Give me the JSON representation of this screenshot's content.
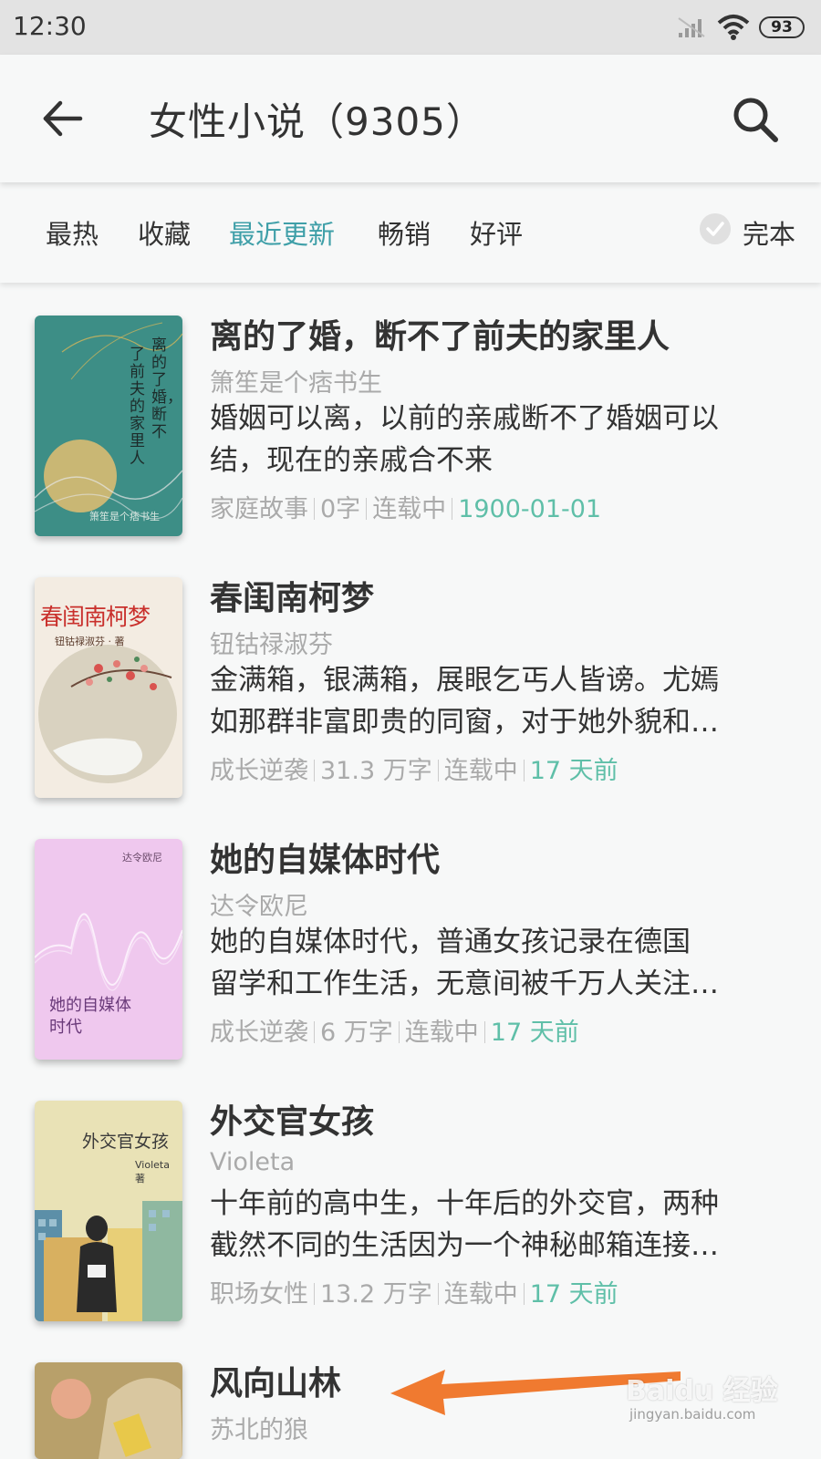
{
  "status_bar": {
    "time": "12:30",
    "battery": "93"
  },
  "header": {
    "title": "女性小说（9305）"
  },
  "filters": {
    "tabs": [
      "最热",
      "收藏",
      "最近更新",
      "畅销",
      "好评"
    ],
    "active_tab": "最近更新",
    "complete_label": "完本"
  },
  "colors": {
    "accent": "#3f9fa8",
    "date": "#5fbfa8",
    "arrow": "#f07a30"
  },
  "books": [
    {
      "title": "离的了婚，断不了前夫的家里人",
      "author": "箫笙是个痞书生",
      "desc_line1": "婚姻可以离，以前的亲戚断不了婚姻可以",
      "desc_line2": "结，现在的亲戚合不来",
      "genre": "家庭故事",
      "words": "0字",
      "status": "连载中",
      "date": "1900-01-01",
      "cover_title_a": "离的了婚，断不",
      "cover_title_b": "了前夫的家里人",
      "cover_author": "箫笙是个痞书生"
    },
    {
      "title": "春闺南柯梦",
      "author": "钮钴禄淑芬",
      "desc_line1": "金满箱，银满箱，展眼乞丐人皆谤。尤嫣",
      "desc_line2": "如那群非富即贵的同窗，对于她外貌和…",
      "genre": "成长逆袭",
      "words": "31.3 万字",
      "status": "连载中",
      "date": "17 天前",
      "cover_title": "春闺南柯梦",
      "cover_author": "钮钴禄淑芬 · 著"
    },
    {
      "title": "她的自媒体时代",
      "author": "达令欧尼",
      "desc_line1": "她的自媒体时代，普通女孩记录在德国",
      "desc_line2": "留学和工作生活，无意间被千万人关注…",
      "genre": "成长逆袭",
      "words": "6 万字",
      "status": "连载中",
      "date": "17 天前",
      "cover_title_a": "她的自媒体",
      "cover_title_b": "时代",
      "cover_author": "达令欧尼"
    },
    {
      "title": "外交官女孩",
      "author": "Violeta",
      "desc_line1": "十年前的高中生，十年后的外交官，两种",
      "desc_line2": "截然不同的生活因为一个神秘邮箱连接…",
      "genre": "职场女性",
      "words": "13.2 万字",
      "status": "连载中",
      "date": "17 天前",
      "cover_title": "外交官女孩",
      "cover_author": "Violeta 著"
    },
    {
      "title": "风向山林",
      "author": "苏北的狼"
    }
  ],
  "watermark": {
    "brand": "Baidu 经验",
    "url": "jingyan.baidu.com"
  }
}
